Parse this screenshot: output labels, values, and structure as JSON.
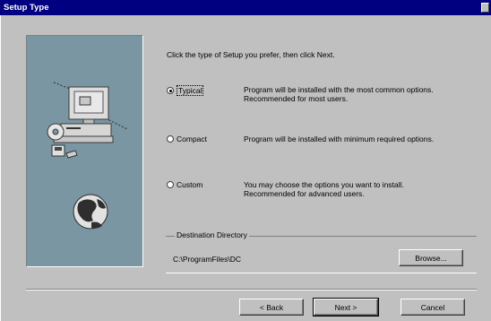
{
  "window": {
    "title": "Setup Type"
  },
  "instruction": "Click the type of Setup you prefer, then click Next.",
  "options": [
    {
      "label": "Typical",
      "checked": true,
      "desc_line1": "Program will be installed with the most common options.",
      "desc_line2": "Recommended for most users."
    },
    {
      "label": "Compact",
      "checked": false,
      "desc_line1": "Program will be installed with minimum required options.",
      "desc_line2": ""
    },
    {
      "label": "Custom",
      "checked": false,
      "desc_line1": "You may choose the options you want to install.",
      "desc_line2": "Recommended for advanced users."
    }
  ],
  "destination": {
    "label": "Destination Directory",
    "path": "C:\\ProgramFiles\\DC",
    "browse_label": "Browse..."
  },
  "buttons": {
    "back": "< Back",
    "next": "Next >",
    "cancel": "Cancel"
  },
  "colors": {
    "titlebar": "#000080",
    "face": "#c0c0c0",
    "art_bg": "#7a96a2"
  }
}
